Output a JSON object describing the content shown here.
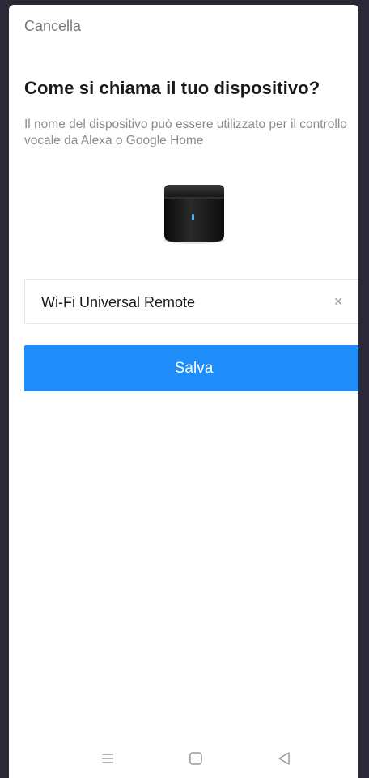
{
  "header": {
    "cancel_label": "Cancella"
  },
  "main": {
    "title": "Come si chiama il tuo dispositivo?",
    "subtitle": "Il nome del dispositivo può essere utilizzato per il controllo vocale da Alexa o Google Home",
    "device_image": "smart-ir-remote-hub",
    "name_field": {
      "value": "Wi-Fi Universal Remote",
      "clear_icon": "close-icon"
    },
    "save_label": "Salva"
  },
  "navbar": {
    "icons": [
      "menu-icon",
      "home-square-icon",
      "back-triangle-icon"
    ]
  },
  "colors": {
    "accent": "#1e8cf9",
    "background_frame": "#2b2838"
  }
}
